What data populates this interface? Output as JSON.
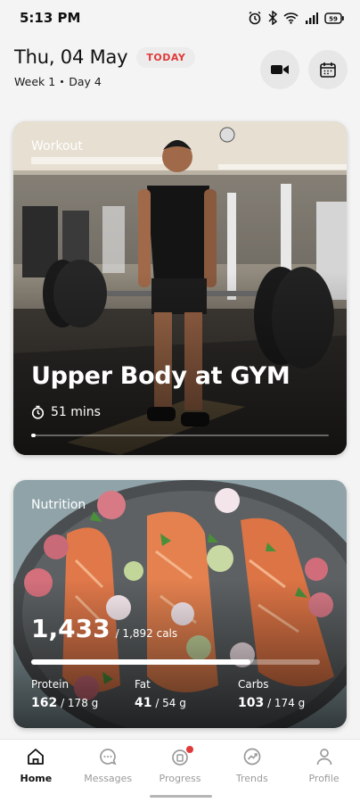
{
  "status_bar": {
    "time": "5:13 PM"
  },
  "header": {
    "date": "Thu, 04 May",
    "today_badge": "TODAY",
    "week": "Week 1",
    "day": "Day 4"
  },
  "workout_card": {
    "label": "Workout",
    "title": "Upper Body at GYM",
    "duration": "51 mins",
    "progress_fraction": 0.01
  },
  "nutrition_card": {
    "label": "Nutrition",
    "calories_consumed": "1,433",
    "calories_goal": "/ 1,892 cals",
    "progress_fraction": 0.76,
    "macros": [
      {
        "name": "Protein",
        "value": "162",
        "goal": "/ 178 g"
      },
      {
        "name": "Fat",
        "value": "41",
        "goal": "/ 54 g"
      },
      {
        "name": "Carbs",
        "value": "103",
        "goal": "/ 174 g"
      }
    ]
  },
  "bottom_nav": [
    {
      "label": "Home",
      "icon": "home-icon",
      "active": true
    },
    {
      "label": "Messages",
      "icon": "chat-icon",
      "active": false
    },
    {
      "label": "Progress",
      "icon": "progress-icon",
      "active": false,
      "badge": true
    },
    {
      "label": "Trends",
      "icon": "trends-icon",
      "active": false
    },
    {
      "label": "Profile",
      "icon": "profile-icon",
      "active": false
    }
  ],
  "colors": {
    "accent_red": "#e03a3a",
    "background": "#f4f4f4"
  }
}
